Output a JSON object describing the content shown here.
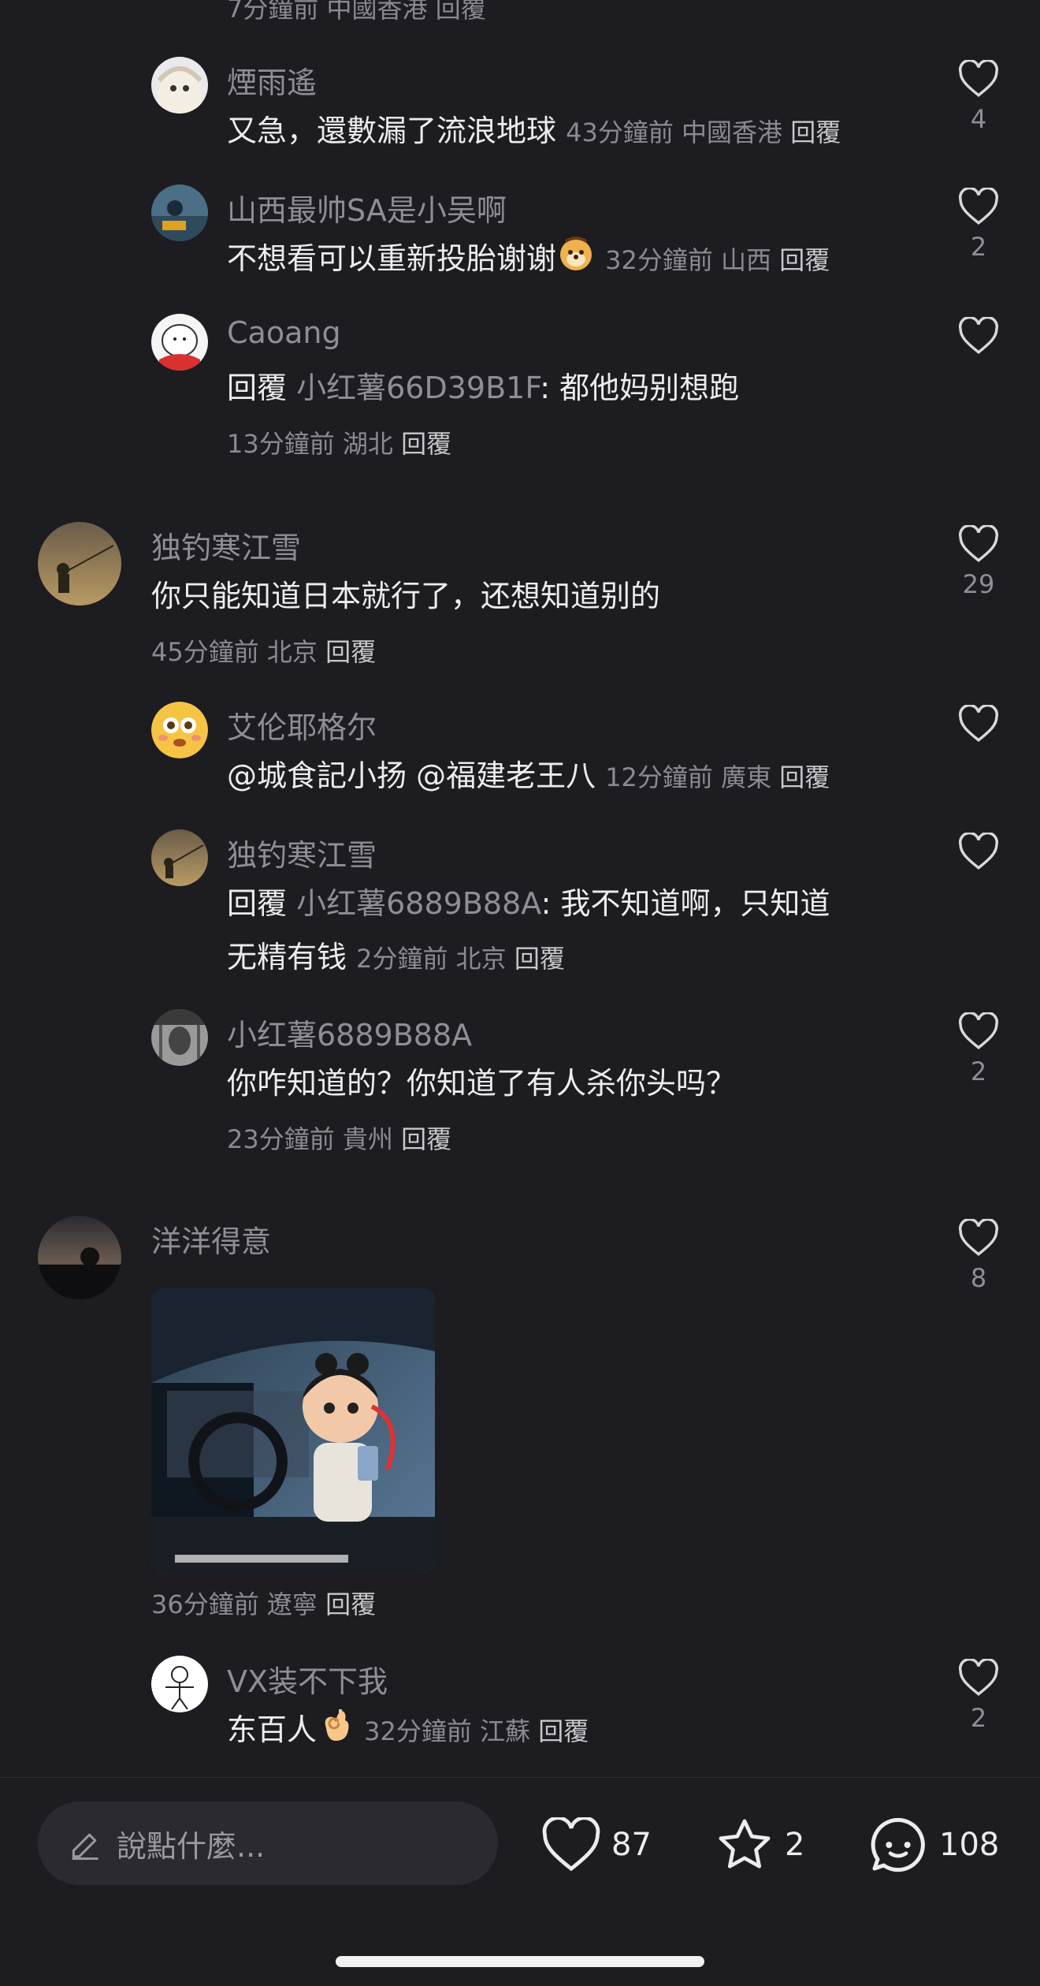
{
  "partial_top_line": "7分鐘前 中國香港 回覆",
  "comments": [
    {
      "username": "煙雨遙",
      "text": "又急，還數漏了流浪地球",
      "time": "43分鐘前",
      "location": "中國香港",
      "reply_label": "回覆",
      "likes": "4"
    },
    {
      "username": "山西最帅SA是小吴啊",
      "text": "不想看可以重新投胎谢谢",
      "emoji": "puppy-face-emoji",
      "time": "32分鐘前",
      "location": "山西",
      "reply_label": "回覆",
      "likes": "2"
    },
    {
      "username": "Caoang",
      "reply_prefix": "回覆",
      "reply_target": "小红薯66D39B1F",
      "text": ": 都他妈别想跑",
      "time": "13分鐘前",
      "location": "湖北",
      "reply_label": "回覆",
      "likes": ""
    },
    {
      "username": "独钓寒江雪",
      "text": "你只能知道日本就行了，还想知道别的",
      "time": "45分鐘前",
      "location": "北京",
      "reply_label": "回覆",
      "likes": "29"
    },
    {
      "username": "艾伦耶格尔",
      "text": "@城食記小扬 @福建老王八",
      "time": "12分鐘前",
      "location": "廣東",
      "reply_label": "回覆",
      "likes": ""
    },
    {
      "username": "独钓寒江雪",
      "reply_prefix": "回覆",
      "reply_target": "小红薯6889B88A",
      "text_line1": ": 我不知道啊，只知道",
      "text_line2": "无精有钱",
      "time": "2分鐘前",
      "location": "北京",
      "reply_label": "回覆",
      "likes": ""
    },
    {
      "username": "小红薯6889B88A",
      "text": "你咋知道的？你知道了有人杀你头吗？",
      "time": "23分鐘前",
      "location": "貴州",
      "reply_label": "回覆",
      "likes": "2"
    },
    {
      "username": "洋洋得意",
      "image_desc": "animated character in car",
      "time": "36分鐘前",
      "location": "遼寧",
      "reply_label": "回覆",
      "likes": "8"
    },
    {
      "username": "VX装不下我",
      "text": "东百人",
      "emoji": "ok-hand-emoji",
      "time": "32分鐘前",
      "location": "江蘇",
      "reply_label": "回覆",
      "likes": "2"
    }
  ],
  "bottom_bar": {
    "input_placeholder": "說點什麼...",
    "likes_count": "87",
    "favorites_count": "2",
    "comments_count": "108"
  },
  "colors": {
    "background": "#1c1c21",
    "text": "#ececee",
    "muted": "#8e8e94",
    "input_bg": "#2a2a30"
  }
}
